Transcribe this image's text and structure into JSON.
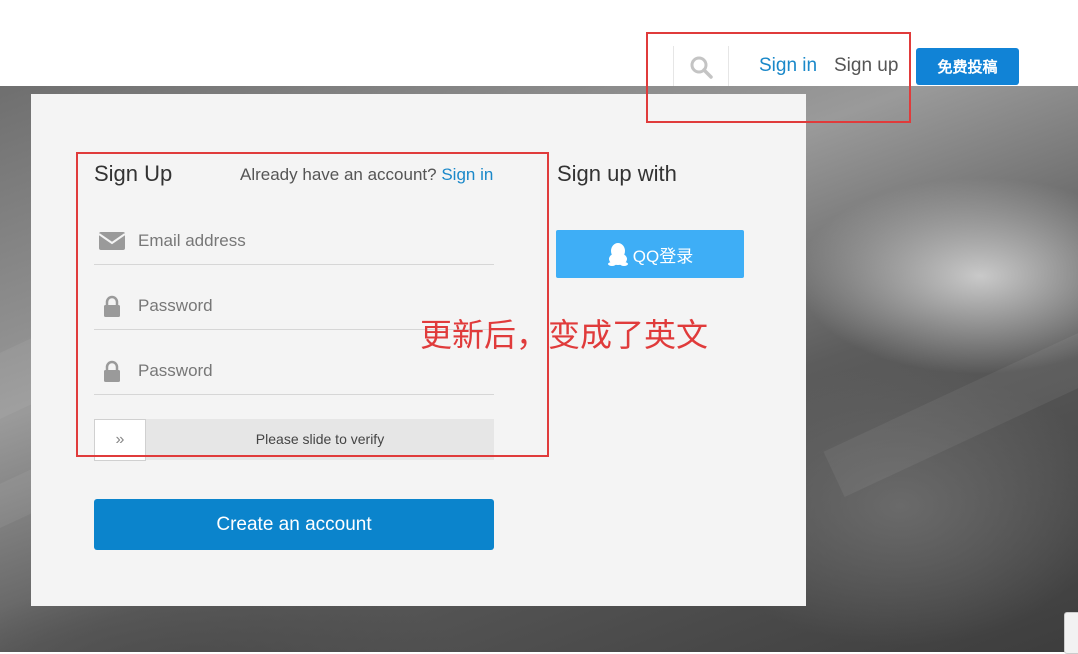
{
  "header": {
    "search_icon": "search-icon",
    "sign_in": "Sign in",
    "sign_up": "Sign up",
    "submit_button": "免费投稿"
  },
  "signup_form": {
    "title": "Sign Up",
    "already_text": "Already have an account?",
    "sign_in_link": "Sign in",
    "email_placeholder": "Email address",
    "password_placeholder": "Password",
    "confirm_password_placeholder": "Password",
    "slider_text": "Please slide to verify",
    "slider_handle": "»",
    "create_button": "Create an account"
  },
  "social": {
    "title": "Sign up with",
    "qq_button": "QQ登录"
  },
  "annotation": {
    "note": "更新后，变成了英文"
  },
  "colors": {
    "brand_blue": "#0b84cc",
    "link_blue": "#1a88c9",
    "qq_blue": "#3eaef6",
    "annotation_red": "#e03b3b"
  }
}
